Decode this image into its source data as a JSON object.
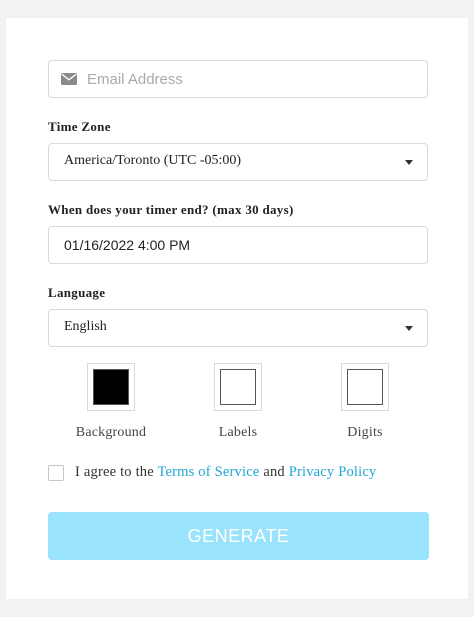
{
  "email": {
    "placeholder": "Email Address",
    "icon": "envelope-icon"
  },
  "timezone": {
    "label": "Time Zone",
    "value": "America/Toronto (UTC -05:00)"
  },
  "end_time": {
    "label": "When does your timer end? (max 30 days)",
    "value": "01/16/2022 4:00 PM"
  },
  "language": {
    "label": "Language",
    "value": "English"
  },
  "colors": [
    {
      "label": "Background",
      "color": "#000000"
    },
    {
      "label": "Labels",
      "color": "#ffffff"
    },
    {
      "label": "Digits",
      "color": "#ffffff"
    }
  ],
  "agree": {
    "prefix": "I agree to the ",
    "terms": "Terms of Service",
    "middle": " and ",
    "privacy": "Privacy Policy",
    "link_color": "#1ea7d6"
  },
  "generate": {
    "label": "GENERATE",
    "color": "#99e3fd"
  }
}
